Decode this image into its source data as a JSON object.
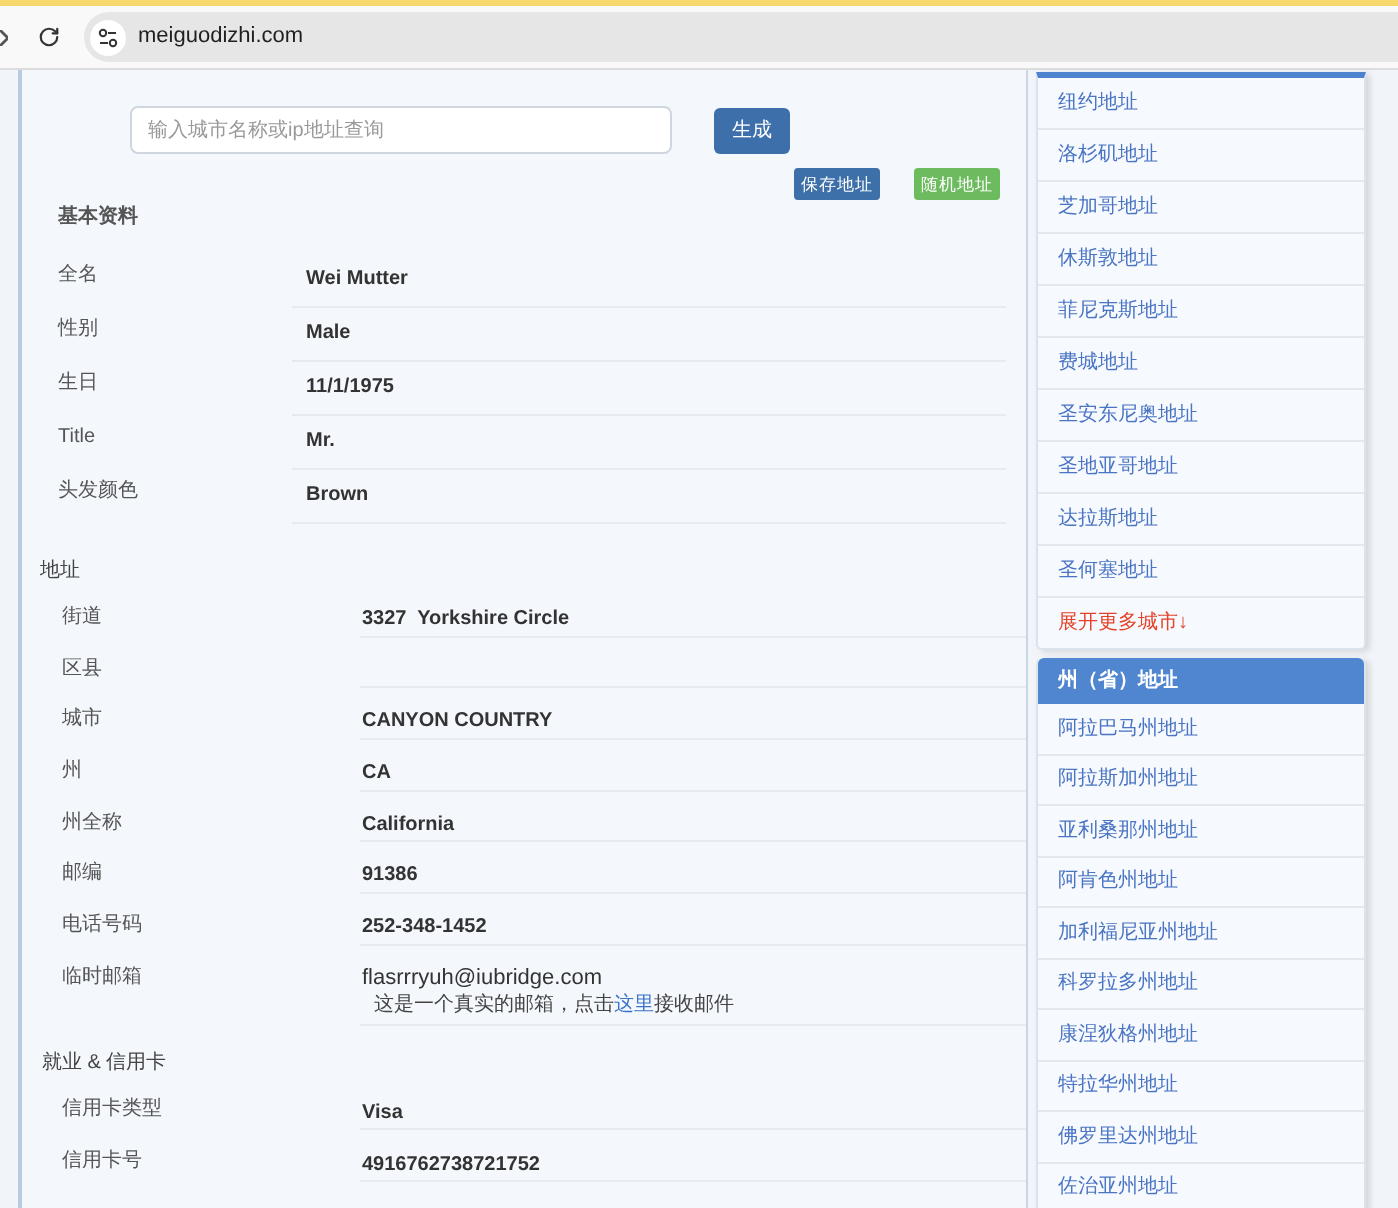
{
  "browser": {
    "url": "meiguodizhi.com"
  },
  "search": {
    "placeholder": "输入城市名称或ip地址查询",
    "button": "生成"
  },
  "actions": [
    {
      "kind": "save",
      "label": "保存地址"
    },
    {
      "kind": "random",
      "label": "随机地址"
    }
  ],
  "sections": [
    {
      "kind": "basic",
      "title": "基本资料",
      "rows": [
        {
          "label": "全名",
          "value": "Wei Mutter"
        },
        {
          "label": "性别",
          "value": "Male"
        },
        {
          "label": "生日",
          "value": "11/1/1975"
        },
        {
          "label": "Title",
          "value": "Mr."
        },
        {
          "label": "头发颜色",
          "value": "Brown"
        }
      ]
    },
    {
      "kind": "address",
      "title": "地址",
      "rows": [
        {
          "label": "街道",
          "value": "3327  Yorkshire Circle"
        },
        {
          "label": "区县"
        },
        {
          "label": "城市",
          "value": "CANYON COUNTRY"
        },
        {
          "label": "州",
          "value": "CA"
        },
        {
          "label": "州全称",
          "value": "California"
        },
        {
          "label": "邮编",
          "value": "91386"
        },
        {
          "label": "电话号码",
          "value": "252-348-1452"
        },
        {
          "label": "临时邮箱",
          "value": "flasrrryuh@iubridge.com",
          "note": {
            "before": "这是一个真实的邮箱，点击",
            "link": "这里",
            "after": "接收邮件"
          }
        }
      ]
    },
    {
      "kind": "card",
      "title": "就业 & 信用卡",
      "rows": [
        {
          "label": "信用卡类型",
          "value": "Visa"
        },
        {
          "label": "信用卡号",
          "value": "4916762738721752"
        }
      ]
    }
  ],
  "sidebar": {
    "city_links": [
      "纽约地址",
      "洛杉矶地址",
      "芝加哥地址",
      "休斯敦地址",
      "菲尼克斯地址",
      "费城地址",
      "圣安东尼奥地址",
      "圣地亚哥地址",
      "达拉斯地址",
      "圣何塞地址"
    ],
    "more_link": "展开更多城市↓",
    "states_heading": "州（省）地址",
    "state_links": [
      "阿拉巴马州地址",
      "阿拉斯加州地址",
      "亚利桑那州地址",
      "阿肯色州地址",
      "加利福尼亚州地址",
      "科罗拉多州地址",
      "康涅狄格州地址",
      "特拉华州地址",
      "佛罗里达州地址",
      "佐治亚州地址"
    ]
  }
}
